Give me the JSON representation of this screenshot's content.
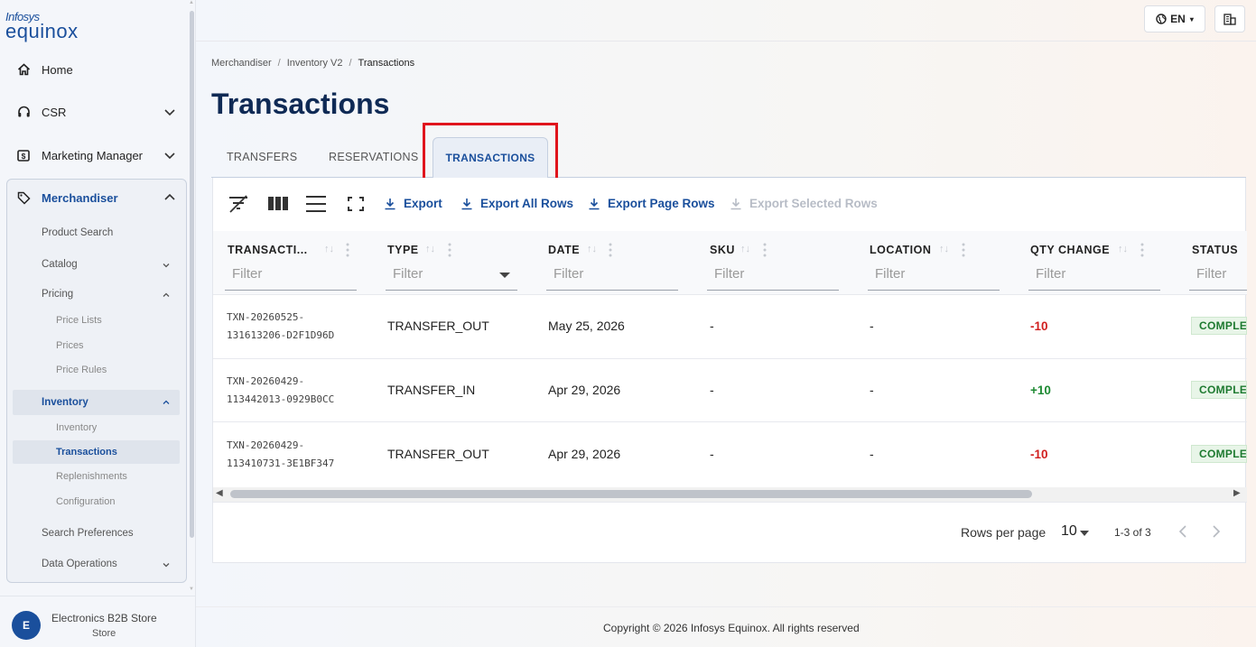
{
  "brand": {
    "line1": "Infosys",
    "line2": "equinox"
  },
  "sidebar": {
    "items": [
      {
        "label": "Home"
      },
      {
        "label": "CSR"
      },
      {
        "label": "Marketing Manager"
      },
      {
        "label": "Merchandiser"
      }
    ],
    "merchandiser": {
      "product_search": "Product Search",
      "catalog": "Catalog",
      "pricing": "Pricing",
      "price_lists": "Price Lists",
      "prices": "Prices",
      "price_rules": "Price Rules",
      "inventory": "Inventory",
      "inventory_sub": "Inventory",
      "transactions": "Transactions",
      "replenishments": "Replenishments",
      "configuration": "Configuration",
      "search_preferences": "Search Preferences",
      "data_operations": "Data Operations"
    },
    "store": {
      "initial": "E",
      "name": "Electronics B2B Store",
      "type": "Store"
    }
  },
  "topbar": {
    "language": "EN"
  },
  "breadcrumb": {
    "a": "Merchandiser",
    "b": "Inventory V2",
    "c": "Transactions",
    "sep": "/"
  },
  "page_title": "Transactions",
  "tabs": {
    "transfers": "TRANSFERS",
    "reservations": "RESERVATIONS",
    "transactions": "TRANSACTIONS"
  },
  "toolbar": {
    "export": "Export",
    "export_all": "Export All Rows",
    "export_page": "Export Page Rows",
    "export_selected": "Export Selected Rows"
  },
  "table": {
    "columns": [
      "TRANSACTI...",
      "TYPE",
      "DATE",
      "SKU",
      "LOCATION",
      "QTY CHANGE",
      "STATUS"
    ],
    "filter_placeholder": "Filter",
    "rows": [
      {
        "id1": "TXN-20260525-",
        "id2": "131613206-D2F1D96D",
        "type": "TRANSFER_OUT",
        "date": "May 25, 2026",
        "sku": "-",
        "location": "-",
        "qty": "-10",
        "status": "COMPLETED"
      },
      {
        "id1": "TXN-20260429-",
        "id2": "113442013-0929B0CC",
        "type": "TRANSFER_IN",
        "date": "Apr 29, 2026",
        "sku": "-",
        "location": "-",
        "qty": "+10",
        "status": "COMPLETED"
      },
      {
        "id1": "TXN-20260429-",
        "id2": "113410731-3E1BF347",
        "type": "TRANSFER_OUT",
        "date": "Apr 29, 2026",
        "sku": "-",
        "location": "-",
        "qty": "-10",
        "status": "COMPLETED"
      }
    ]
  },
  "pagination": {
    "rows_per_page_label": "Rows per page",
    "rows_per_page": "10",
    "range": "1-3 of 3"
  },
  "footer": "Copyright © 2026 Infosys Equinox. All rights reserved",
  "colors": {
    "brand": "#1a4f9c",
    "negative": "#d11f1f",
    "positive": "#1e8a33",
    "highlight": "#e0141c"
  }
}
